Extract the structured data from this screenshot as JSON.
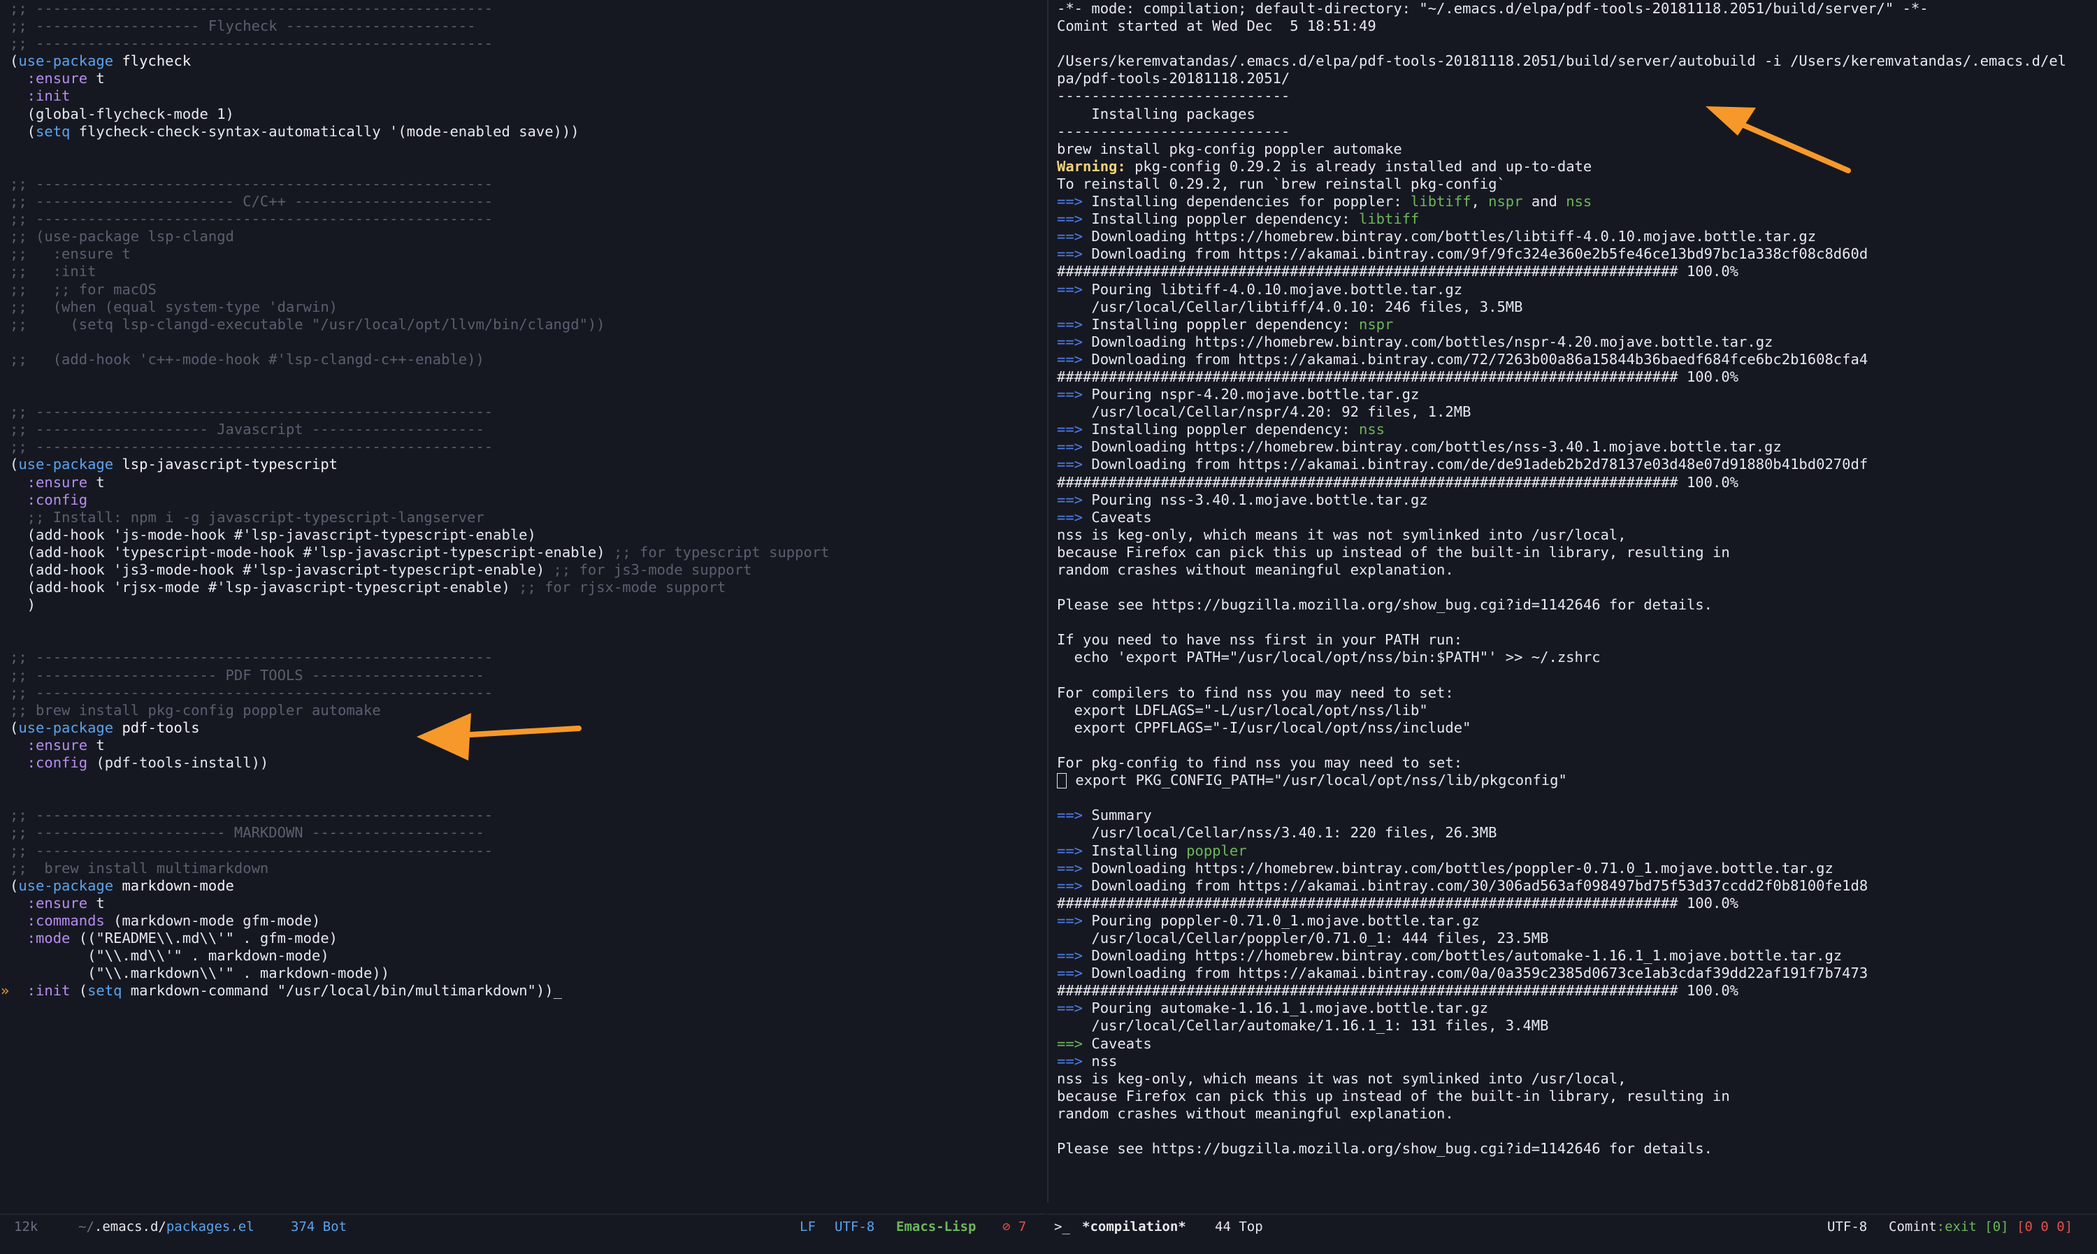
{
  "left_buffer": {
    "lines": [
      [
        {
          "t": ";; -----------------------------------------------------",
          "c": "comment"
        }
      ],
      [
        {
          "t": ";; ------------------- Flycheck ----------------------",
          "c": "comment"
        }
      ],
      [
        {
          "t": ";; -----------------------------------------------------",
          "c": "comment"
        }
      ],
      [
        {
          "t": "(",
          "c": "plain"
        },
        {
          "t": "use-package",
          "c": "kw"
        },
        {
          "t": " flycheck",
          "c": "fn"
        }
      ],
      [
        {
          "t": "  :ensure",
          "c": "key"
        },
        {
          "t": " t",
          "c": "plain"
        }
      ],
      [
        {
          "t": "  :init",
          "c": "key"
        }
      ],
      [
        {
          "t": "  (global-flycheck-mode 1)",
          "c": "plain"
        }
      ],
      [
        {
          "t": "  (",
          "c": "plain"
        },
        {
          "t": "setq",
          "c": "kw"
        },
        {
          "t": " flycheck-check-syntax-automatically '(mode-enabled save)))",
          "c": "plain"
        }
      ],
      [],
      [],
      [
        {
          "t": ";; -----------------------------------------------------",
          "c": "comment"
        }
      ],
      [
        {
          "t": ";; ----------------------- C/C++ -----------------------",
          "c": "comment"
        }
      ],
      [
        {
          "t": ";; -----------------------------------------------------",
          "c": "comment"
        }
      ],
      [
        {
          "t": ";; (use-package lsp-clangd",
          "c": "comment"
        }
      ],
      [
        {
          "t": ";;   :ensure t",
          "c": "comment"
        }
      ],
      [
        {
          "t": ";;   :init",
          "c": "comment"
        }
      ],
      [
        {
          "t": ";;   ;; for macOS",
          "c": "comment"
        }
      ],
      [
        {
          "t": ";;   (when (equal system-type 'darwin)",
          "c": "comment"
        }
      ],
      [
        {
          "t": ";;     (setq lsp-clangd-executable \"/usr/local/opt/llvm/bin/clangd\"))",
          "c": "comment"
        }
      ],
      [],
      [
        {
          "t": ";;   (add-hook 'c++-mode-hook #'lsp-clangd-c++-enable))",
          "c": "comment"
        }
      ],
      [],
      [],
      [
        {
          "t": ";; -----------------------------------------------------",
          "c": "comment"
        }
      ],
      [
        {
          "t": ";; -------------------- Javascript --------------------",
          "c": "comment"
        }
      ],
      [
        {
          "t": ";; -----------------------------------------------------",
          "c": "comment"
        }
      ],
      [
        {
          "t": "(",
          "c": "plain"
        },
        {
          "t": "use-package",
          "c": "kw"
        },
        {
          "t": " lsp-javascript-typescript",
          "c": "fn"
        }
      ],
      [
        {
          "t": "  :ensure",
          "c": "key"
        },
        {
          "t": " t",
          "c": "plain"
        }
      ],
      [
        {
          "t": "  :config",
          "c": "key"
        }
      ],
      [
        {
          "t": "  ;; Install: npm i -g javascript-typescript-langserver",
          "c": "comment"
        }
      ],
      [
        {
          "t": "  (add-hook 'js-mode-hook #'lsp-javascript-typescript-enable)",
          "c": "plain"
        }
      ],
      [
        {
          "t": "  (add-hook 'typescript-mode-hook #'lsp-javascript-typescript-enable)",
          "c": "plain"
        },
        {
          "t": " ;; for typescript support",
          "c": "comment"
        }
      ],
      [
        {
          "t": "  (add-hook 'js3-mode-hook #'lsp-javascript-typescript-enable)",
          "c": "plain"
        },
        {
          "t": " ;; for js3-mode support",
          "c": "comment"
        }
      ],
      [
        {
          "t": "  (add-hook 'rjsx-mode #'lsp-javascript-typescript-enable)",
          "c": "plain"
        },
        {
          "t": " ;; for rjsx-mode support",
          "c": "comment"
        }
      ],
      [
        {
          "t": "  )",
          "c": "plain"
        }
      ],
      [],
      [],
      [
        {
          "t": ";; -----------------------------------------------------",
          "c": "comment"
        }
      ],
      [
        {
          "t": ";; --------------------- PDF TOOLS --------------------",
          "c": "comment"
        }
      ],
      [
        {
          "t": ";; -----------------------------------------------------",
          "c": "comment"
        }
      ],
      [
        {
          "t": ";; brew install pkg-config poppler automake",
          "c": "comment"
        }
      ],
      [
        {
          "t": "(",
          "c": "plain"
        },
        {
          "t": "use-package",
          "c": "kw"
        },
        {
          "t": " pdf-tools",
          "c": "fn"
        }
      ],
      [
        {
          "t": "  :ensure",
          "c": "key"
        },
        {
          "t": " t",
          "c": "plain"
        }
      ],
      [
        {
          "t": "  :config",
          "c": "key"
        },
        {
          "t": " (pdf-tools-install))",
          "c": "plain"
        }
      ],
      [],
      [],
      [
        {
          "t": ";; -----------------------------------------------------",
          "c": "comment"
        }
      ],
      [
        {
          "t": ";; ---------------------- MARKDOWN --------------------",
          "c": "comment"
        }
      ],
      [
        {
          "t": ";; -----------------------------------------------------",
          "c": "comment"
        }
      ],
      [
        {
          "t": ";;  brew install multimarkdown",
          "c": "comment"
        }
      ],
      [
        {
          "t": "(",
          "c": "plain"
        },
        {
          "t": "use-package",
          "c": "kw"
        },
        {
          "t": " markdown-mode",
          "c": "fn"
        }
      ],
      [
        {
          "t": "  :ensure",
          "c": "key"
        },
        {
          "t": " t",
          "c": "plain"
        }
      ],
      [
        {
          "t": "  :commands",
          "c": "key"
        },
        {
          "t": " (markdown-mode gfm-mode)",
          "c": "plain"
        }
      ],
      [
        {
          "t": "  :mode",
          "c": "key"
        },
        {
          "t": " ((\"README\\\\.md\\\\'\" . gfm-mode)",
          "c": "plain"
        }
      ],
      [
        {
          "t": "         (\"\\\\.md\\\\'\" . markdown-mode)",
          "c": "plain"
        }
      ],
      [
        {
          "t": "         (\"\\\\.markdown\\\\'\" . markdown-mode))",
          "c": "plain"
        }
      ],
      [
        {
          "t": "  :init",
          "c": "key"
        },
        {
          "t": " (",
          "c": "plain"
        },
        {
          "t": "setq",
          "c": "kw"
        },
        {
          "t": " markdown-command \"/usr/local/bin/multimarkdown\"))_",
          "c": "plain"
        }
      ]
    ],
    "gutter_marker": "»"
  },
  "right_buffer": {
    "lines": [
      [
        {
          "t": "-*- mode: compilation; default-directory: \"~/.emacs.d/elpa/pdf-tools-20181118.2051/build/server/\" -*-",
          "c": "plain"
        }
      ],
      [
        {
          "t": "Comint started at Wed Dec  5 18:51:49",
          "c": "plain"
        }
      ],
      [],
      [
        {
          "t": "/Users/keremvatandas/.emacs.d/elpa/pdf-tools-20181118.2051/build/server/autobuild -i /Users/keremvatandas/.emacs.d/el",
          "c": "plain"
        }
      ],
      [
        {
          "t": "pa/pdf-tools-20181118.2051/",
          "c": "plain"
        }
      ],
      [
        {
          "t": "---------------------------",
          "c": "plain"
        }
      ],
      [
        {
          "t": "    Installing packages",
          "c": "plain"
        }
      ],
      [
        {
          "t": "---------------------------",
          "c": "plain"
        }
      ],
      [
        {
          "t": "brew install pkg-config poppler automake",
          "c": "plain"
        }
      ],
      [
        {
          "t": "Warning:",
          "c": "warn"
        },
        {
          "t": " pkg-config 0.29.2 is already installed and up-to-date",
          "c": "plain"
        }
      ],
      [
        {
          "t": "To reinstall 0.29.2, run `brew reinstall pkg-config`",
          "c": "plain"
        }
      ],
      [
        {
          "t": "==>",
          "c": "arrow"
        },
        {
          "t": " Installing dependencies for poppler: ",
          "c": "plain"
        },
        {
          "t": "libtiff",
          "c": "green"
        },
        {
          "t": ", ",
          "c": "plain"
        },
        {
          "t": "nspr",
          "c": "green"
        },
        {
          "t": " and ",
          "c": "plain"
        },
        {
          "t": "nss",
          "c": "green"
        }
      ],
      [
        {
          "t": "==>",
          "c": "arrow"
        },
        {
          "t": " Installing poppler dependency: ",
          "c": "plain"
        },
        {
          "t": "libtiff",
          "c": "green"
        }
      ],
      [
        {
          "t": "==>",
          "c": "arrow"
        },
        {
          "t": " Downloading https://homebrew.bintray.com/bottles/libtiff-4.0.10.mojave.bottle.tar.gz",
          "c": "plain"
        }
      ],
      [
        {
          "t": "==>",
          "c": "arrow"
        },
        {
          "t": " Downloading from https://akamai.bintray.com/9f/9fc324e360e2b5fe46ce13bd97bc1a338cf08c8d60d",
          "c": "plain"
        }
      ],
      [
        {
          "t": "######################################################################## 100.0%",
          "c": "plain"
        }
      ],
      [
        {
          "t": "==>",
          "c": "arrow"
        },
        {
          "t": " Pouring libtiff-4.0.10.mojave.bottle.tar.gz",
          "c": "plain"
        }
      ],
      [
        {
          "t": "    /usr/local/Cellar/libtiff/4.0.10: 246 files, 3.5MB",
          "c": "plain"
        }
      ],
      [
        {
          "t": "==>",
          "c": "arrow"
        },
        {
          "t": " Installing poppler dependency: ",
          "c": "plain"
        },
        {
          "t": "nspr",
          "c": "green"
        }
      ],
      [
        {
          "t": "==>",
          "c": "arrow"
        },
        {
          "t": " Downloading https://homebrew.bintray.com/bottles/nspr-4.20.mojave.bottle.tar.gz",
          "c": "plain"
        }
      ],
      [
        {
          "t": "==>",
          "c": "arrow"
        },
        {
          "t": " Downloading from https://akamai.bintray.com/72/7263b00a86a15844b36baedf684fce6bc2b1608cfa4",
          "c": "plain"
        }
      ],
      [
        {
          "t": "######################################################################## 100.0%",
          "c": "plain"
        }
      ],
      [
        {
          "t": "==>",
          "c": "arrow"
        },
        {
          "t": " Pouring nspr-4.20.mojave.bottle.tar.gz",
          "c": "plain"
        }
      ],
      [
        {
          "t": "    /usr/local/Cellar/nspr/4.20: 92 files, 1.2MB",
          "c": "plain"
        }
      ],
      [
        {
          "t": "==>",
          "c": "arrow"
        },
        {
          "t": " Installing poppler dependency: ",
          "c": "plain"
        },
        {
          "t": "nss",
          "c": "green"
        }
      ],
      [
        {
          "t": "==>",
          "c": "arrow"
        },
        {
          "t": " Downloading https://homebrew.bintray.com/bottles/nss-3.40.1.mojave.bottle.tar.gz",
          "c": "plain"
        }
      ],
      [
        {
          "t": "==>",
          "c": "arrow"
        },
        {
          "t": " Downloading from https://akamai.bintray.com/de/de91adeb2b2d78137e03d48e07d91880b41bd0270df",
          "c": "plain"
        }
      ],
      [
        {
          "t": "######################################################################## 100.0%",
          "c": "plain"
        }
      ],
      [
        {
          "t": "==>",
          "c": "arrow"
        },
        {
          "t": " Pouring nss-3.40.1.mojave.bottle.tar.gz",
          "c": "plain"
        }
      ],
      [
        {
          "t": "==>",
          "c": "arrow"
        },
        {
          "t": " Caveats",
          "c": "plain"
        }
      ],
      [
        {
          "t": "nss is keg-only, which means it was not symlinked into /usr/local,",
          "c": "plain"
        }
      ],
      [
        {
          "t": "because Firefox can pick this up instead of the built-in library, resulting in",
          "c": "plain"
        }
      ],
      [
        {
          "t": "random crashes without meaningful explanation.",
          "c": "plain"
        }
      ],
      [],
      [
        {
          "t": "Please see https://bugzilla.mozilla.org/show_bug.cgi?id=1142646 for details.",
          "c": "plain"
        }
      ],
      [],
      [
        {
          "t": "If you need to have nss first in your PATH run:",
          "c": "plain"
        }
      ],
      [
        {
          "t": "  echo 'export PATH=\"/usr/local/opt/nss/bin:$PATH\"' >> ~/.zshrc",
          "c": "plain"
        }
      ],
      [],
      [
        {
          "t": "For compilers to find nss you may need to set:",
          "c": "plain"
        }
      ],
      [
        {
          "t": "  export LDFLAGS=\"-L/usr/local/opt/nss/lib\"",
          "c": "plain"
        }
      ],
      [
        {
          "t": "  export CPPFLAGS=\"-I/usr/local/opt/nss/include\"",
          "c": "plain"
        }
      ],
      [],
      [
        {
          "t": "For pkg-config to find nss you may need to set:",
          "c": "plain"
        }
      ],
      [
        {
          "t": "CURSOR",
          "c": "cursor"
        },
        {
          "t": " export PKG_CONFIG_PATH=\"/usr/local/opt/nss/lib/pkgconfig\"",
          "c": "plain"
        }
      ],
      [],
      [
        {
          "t": "==>",
          "c": "arrow"
        },
        {
          "t": " Summary",
          "c": "plain"
        }
      ],
      [
        {
          "t": "    /usr/local/Cellar/nss/3.40.1: 220 files, 26.3MB",
          "c": "plain"
        }
      ],
      [
        {
          "t": "==>",
          "c": "arrow"
        },
        {
          "t": " Installing ",
          "c": "plain"
        },
        {
          "t": "poppler",
          "c": "green"
        }
      ],
      [
        {
          "t": "==>",
          "c": "arrow"
        },
        {
          "t": " Downloading https://homebrew.bintray.com/bottles/poppler-0.71.0_1.mojave.bottle.tar.gz",
          "c": "plain"
        }
      ],
      [
        {
          "t": "==>",
          "c": "arrow"
        },
        {
          "t": " Downloading from https://akamai.bintray.com/30/306ad563af098497bd75f53d37ccdd2f0b8100fe1d8",
          "c": "plain"
        }
      ],
      [
        {
          "t": "######################################################################## 100.0%",
          "c": "plain"
        }
      ],
      [
        {
          "t": "==>",
          "c": "arrow"
        },
        {
          "t": " Pouring poppler-0.71.0_1.mojave.bottle.tar.gz",
          "c": "plain"
        }
      ],
      [
        {
          "t": "    /usr/local/Cellar/poppler/0.71.0_1: 444 files, 23.5MB",
          "c": "plain"
        }
      ],
      [
        {
          "t": "==>",
          "c": "arrow"
        },
        {
          "t": " Downloading https://homebrew.bintray.com/bottles/automake-1.16.1_1.mojave.bottle.tar.gz",
          "c": "plain"
        }
      ],
      [
        {
          "t": "==>",
          "c": "arrow"
        },
        {
          "t": " Downloading from https://akamai.bintray.com/0a/0a359c2385d0673ce1ab3cdaf39dd22af191f7b7473",
          "c": "plain"
        }
      ],
      [
        {
          "t": "######################################################################## 100.0%",
          "c": "plain"
        }
      ],
      [
        {
          "t": "==>",
          "c": "arrow"
        },
        {
          "t": " Pouring automake-1.16.1_1.mojave.bottle.tar.gz",
          "c": "plain"
        }
      ],
      [
        {
          "t": "    /usr/local/Cellar/automake/1.16.1_1: 131 files, 3.4MB",
          "c": "plain"
        }
      ],
      [
        {
          "t": "==>",
          "c": "green"
        },
        {
          "t": " Caveats",
          "c": "plain"
        }
      ],
      [
        {
          "t": "==>",
          "c": "arrow"
        },
        {
          "t": " nss",
          "c": "plain"
        }
      ],
      [
        {
          "t": "nss is keg-only, which means it was not symlinked into /usr/local,",
          "c": "plain"
        }
      ],
      [
        {
          "t": "because Firefox can pick this up instead of the built-in library, resulting in",
          "c": "plain"
        }
      ],
      [
        {
          "t": "random crashes without meaningful explanation.",
          "c": "plain"
        }
      ],
      [],
      [
        {
          "t": "Please see https://bugzilla.mozilla.org/show_bug.cgi?id=1142646 for details.",
          "c": "plain"
        }
      ]
    ]
  },
  "modeline_left": {
    "size": "12k",
    "path_prefix": "~/",
    "path_dir": ".emacs.d/",
    "path_file": "packages.el",
    "position": "374 Bot",
    "eol": "LF",
    "encoding": "UTF-8",
    "major_mode": "Emacs-Lisp",
    "error_count": "7"
  },
  "modeline_right": {
    "prompt": ">_",
    "buffer_name": "*compilation*",
    "position": "44 Top",
    "encoding": "UTF-8",
    "mode_name": "Comint",
    "process_status": ":exit",
    "exit_code": "[0]",
    "counters": "[0 0 0]"
  },
  "colors": {
    "background": "#161821",
    "keyword": "#5ba3ef",
    "keyword_arg": "#b78cf0",
    "comment": "#5a5f6f",
    "arrow_annotation": "#f7992a",
    "success": "#6cb75a",
    "error": "#e0524a"
  }
}
